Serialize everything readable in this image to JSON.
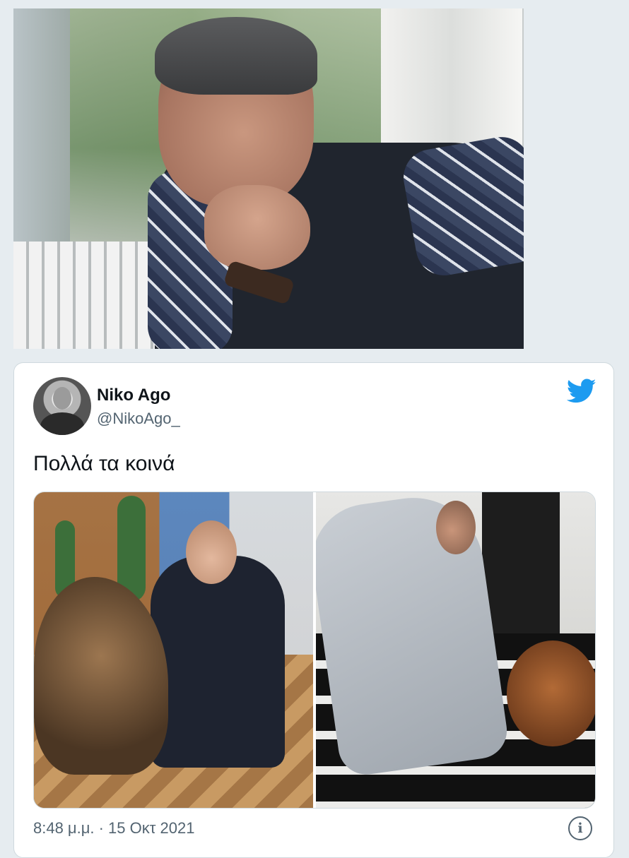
{
  "top_photo": {
    "description_icon": "photo-portrait"
  },
  "tweet": {
    "author_name": "Niko Ago",
    "author_handle": "@NikoAgo_",
    "text": "Πολλά τα κοινά",
    "timestamp": "8:48 μ.μ. · 15 Οκτ 2021",
    "brand_icon": "twitter-bird-icon",
    "info_icon": "info-icon",
    "info_glyph": "i",
    "colors": {
      "brand": "#1d9bf0",
      "text": "#0f1419",
      "muted": "#536471",
      "background": "#e6ecf0"
    }
  }
}
